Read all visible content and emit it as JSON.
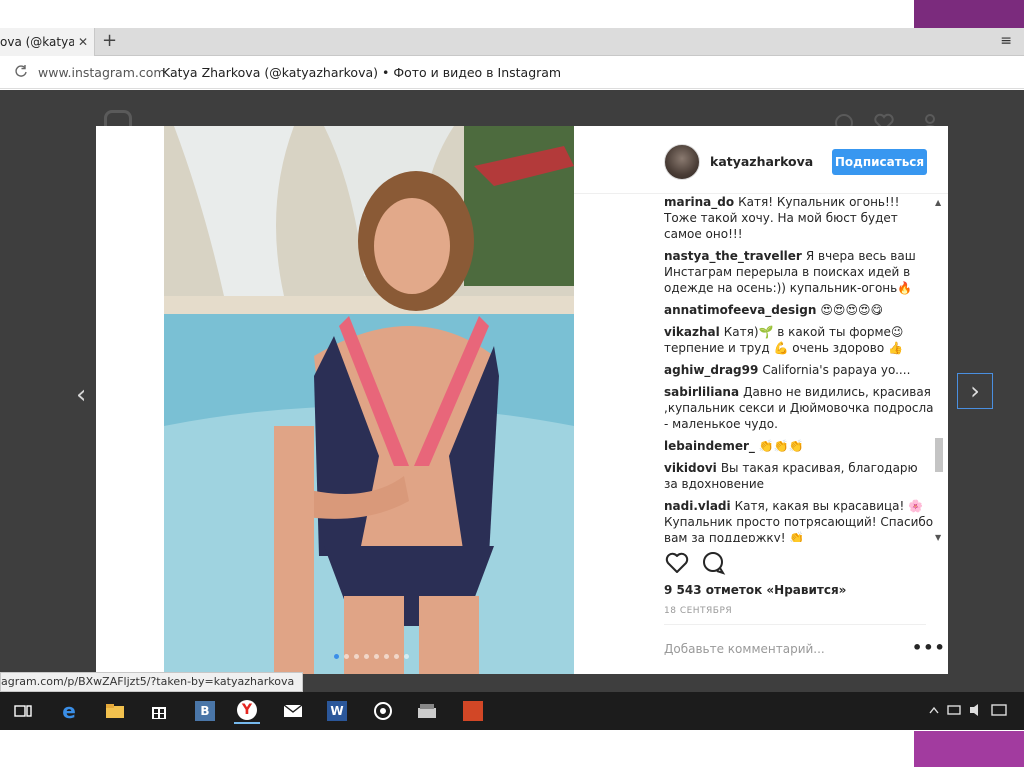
{
  "browser": {
    "tab_title": "ova (@katyazt",
    "tab_close": "✕",
    "new_tab": "+",
    "menu_icon": "≡",
    "url": "www.instagram.com",
    "page_title": "Katya Zharkova (@katyazharkova) • Фото и видео в Instagram",
    "status_link": "agram.com/p/BXwZAFljzt5/?taken-by=katyazharkova"
  },
  "post": {
    "username": "katyazharkova",
    "follow_label": "Подписаться",
    "comments": [
      {
        "author": "marina_do",
        "text": "Катя! Купальник огонь!!! Тоже такой хочу. На мой бюст будет самое оно!!!"
      },
      {
        "author": "nastya_the_traveller",
        "text": "Я вчера весь ваш Инстаграм перерыла в поисках идей в одежде на осень:)) купальник-огонь🔥"
      },
      {
        "author": "annatimofeeva_design",
        "text": "😍😍😍😍😋"
      },
      {
        "author": "vikazhal",
        "text": "Катя)🌱 в какой ты форме😉 терпение и труд 💪 очень здорово 👍"
      },
      {
        "author": "aghiw_drag99",
        "text": "California's papaya yo...."
      },
      {
        "author": "sabirliliana",
        "text": "Давно не видились, красивая ,купальник секси и Дюймовочка подросла - маленькое чудо."
      },
      {
        "author": "lebaindemer_",
        "text": "👏👏👏"
      },
      {
        "author": "vikidovi",
        "text": "Вы такая красивая, благодарю за вдохновение"
      },
      {
        "author": "nadi.vladi",
        "text": "Катя, какая вы красавица! 🌸 Купальник просто потрясающий! Спасибо вам за поддержку! 👏"
      }
    ],
    "likes": "9 543 отметок «Нравится»",
    "date": "18 СЕНТЯБРЯ",
    "add_comment_placeholder": "Добавьте комментарий...",
    "more_icon": "•••"
  },
  "nav": {
    "prev_arrow": "‹",
    "next_arrow": "›"
  },
  "colors": {
    "follow_button": "#3897f0",
    "backdrop": "#3e3e3e",
    "accent": "#a23b9f"
  }
}
